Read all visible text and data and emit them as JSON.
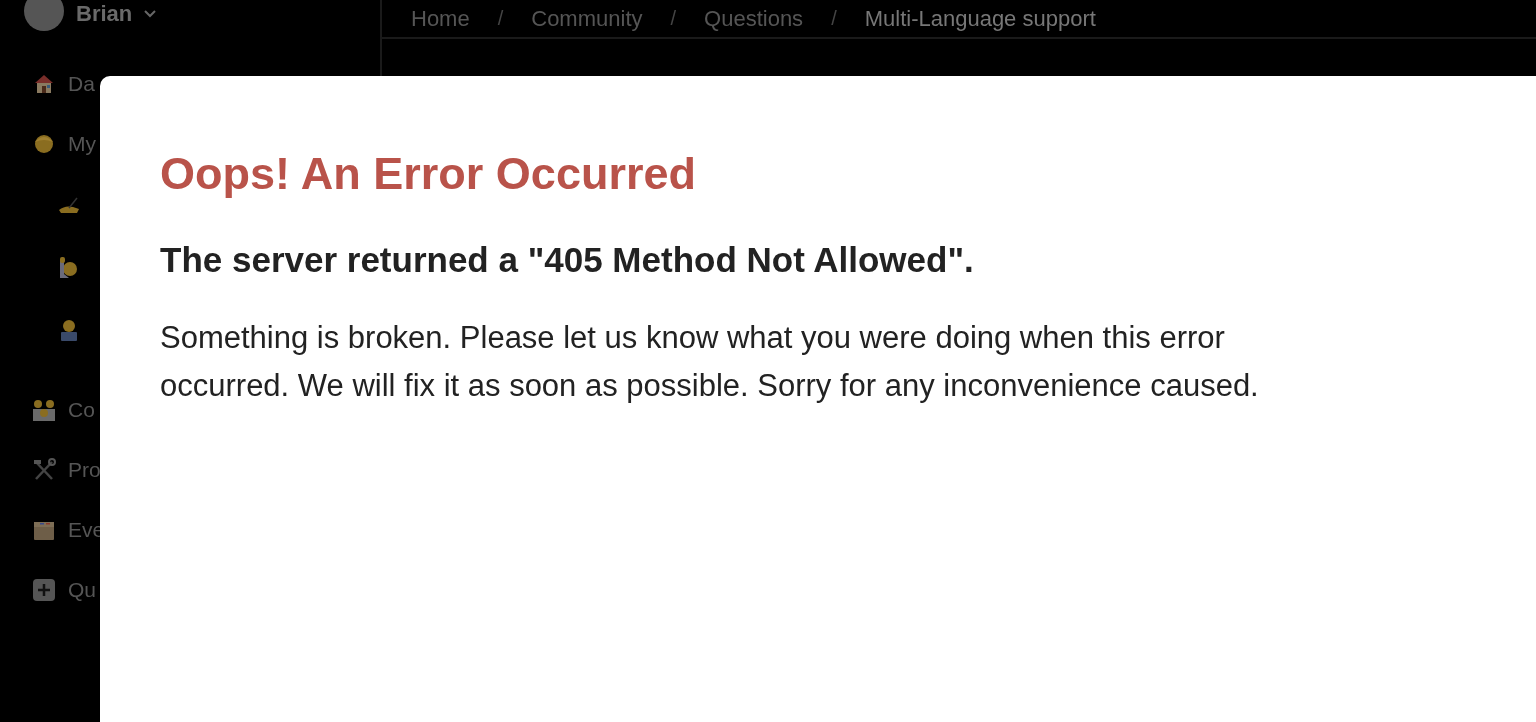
{
  "sidebar": {
    "user": {
      "name": "Brian"
    },
    "items": [
      {
        "kind": "house",
        "label": "Da"
      },
      {
        "kind": "person",
        "label": "My",
        "children": [
          {
            "kind": "writing"
          },
          {
            "kind": "raising"
          },
          {
            "kind": "laptop"
          }
        ]
      },
      {
        "kind": "family",
        "label": "Co"
      },
      {
        "kind": "tools",
        "label": "Pro"
      },
      {
        "kind": "box",
        "label": "Eve"
      },
      {
        "kind": "plus",
        "label": "Qu"
      }
    ]
  },
  "breadcrumb": {
    "separator": "/",
    "items": [
      {
        "label": "Home"
      },
      {
        "label": "Community"
      },
      {
        "label": "Questions"
      },
      {
        "label": "Multi-Language support"
      }
    ]
  },
  "dialog": {
    "title": "Oops! An Error Occurred",
    "subtitle": "The server returned a \"405 Method Not Allowed\".",
    "message": "Something is broken. Please let us know what you were doing when this error occurred. We will fix it as soon as possible. Sorry for any inconvenience caused."
  }
}
